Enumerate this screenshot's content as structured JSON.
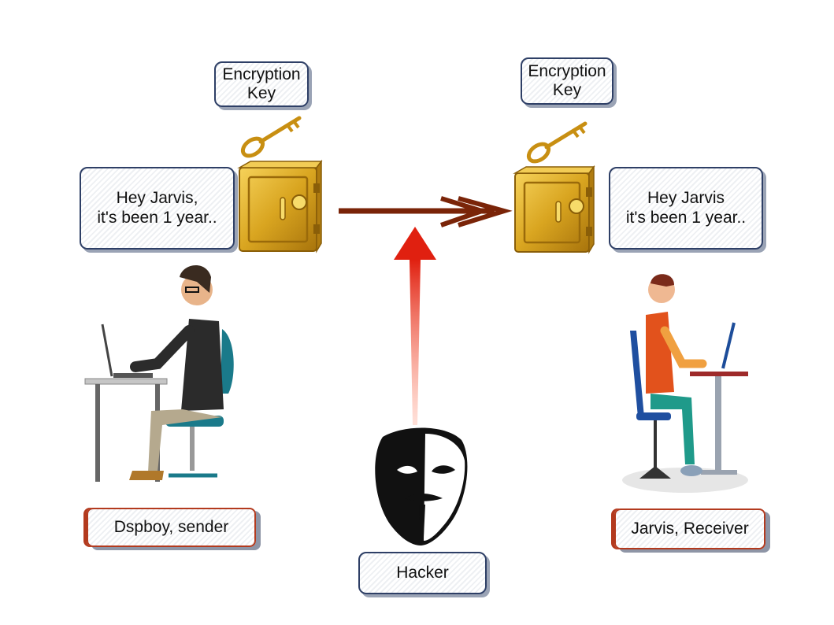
{
  "boxes": {
    "enc_key_left": "Encryption\nKey",
    "enc_key_right": "Encryption\nKey",
    "message_sender": "Hey Jarvis,\nit's been 1 year..",
    "message_receiver": "Hey Jarvis\nit's been 1 year..",
    "sender_label": "Dspboy, sender",
    "receiver_label": "Jarvis, Receiver",
    "hacker_label": "Hacker"
  },
  "colors": {
    "box_border": "#2e3f66",
    "label_border": "#b33a1e",
    "transfer_arrow": "#7a2408",
    "attack_arrow": "#e02010",
    "safe_gold": "#d9a520"
  },
  "icons": [
    "key-icon",
    "safe-icon",
    "sender-person-icon",
    "receiver-person-icon",
    "hacker-mask-icon"
  ]
}
